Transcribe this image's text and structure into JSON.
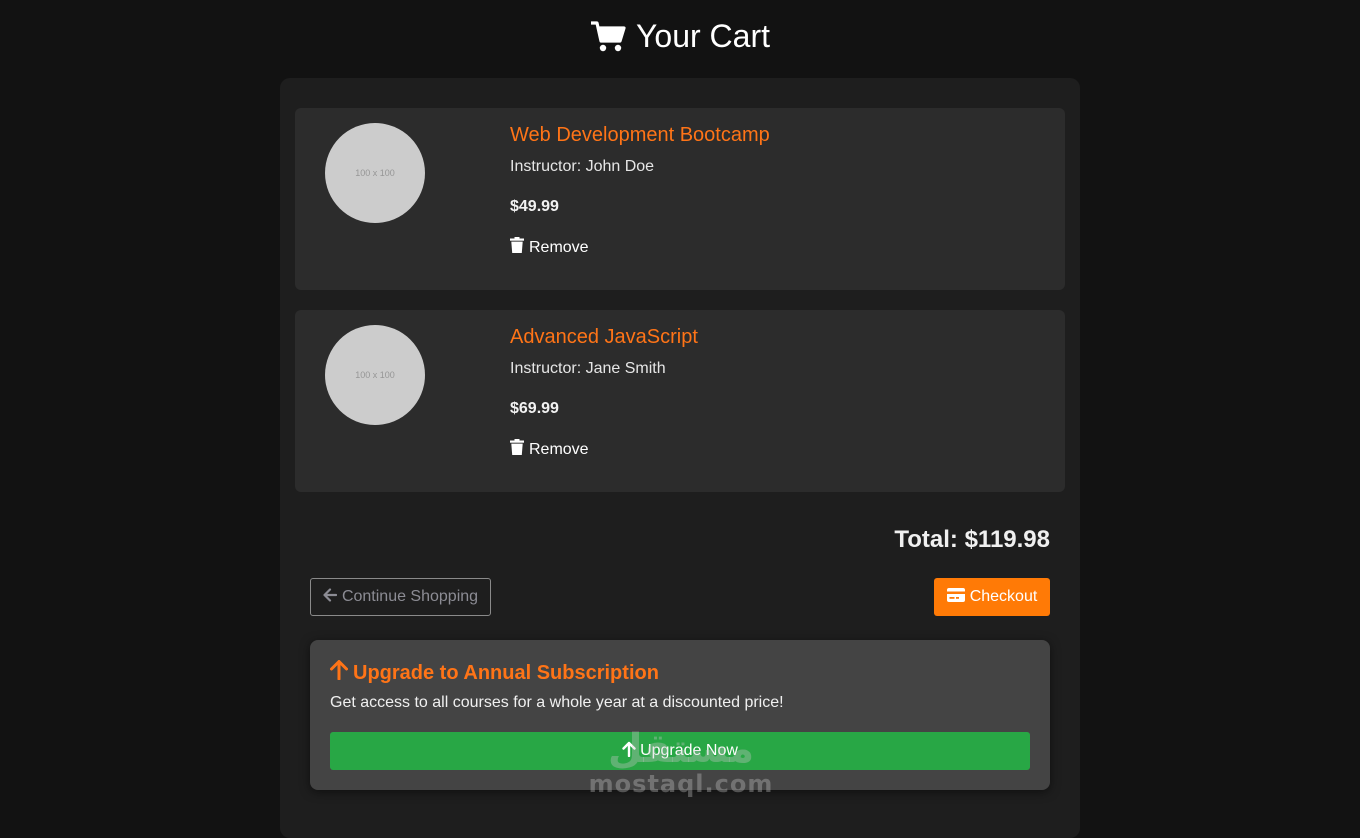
{
  "header": {
    "title": "Your Cart"
  },
  "courses": [
    {
      "title": "Web Development Bootcamp",
      "instructor": "Instructor: John Doe",
      "price": "$49.99",
      "thumb_text": "100 x 100",
      "remove_label": "Remove"
    },
    {
      "title": "Advanced JavaScript",
      "instructor": "Instructor: Jane Smith",
      "price": "$69.99",
      "thumb_text": "100 x 100",
      "remove_label": "Remove"
    }
  ],
  "summary": {
    "total": "Total: $119.98"
  },
  "actions": {
    "continue_label": "Continue Shopping",
    "checkout_label": "Checkout"
  },
  "upgrade": {
    "title": "Upgrade to Annual Subscription",
    "description": "Get access to all courses for a whole year at a discounted price!",
    "button_label": "Upgrade Now"
  },
  "watermark": {
    "logo": "مستقل",
    "text": "mostaql.com"
  },
  "colors": {
    "accent": "#ff7417",
    "checkout": "#ff7a06",
    "upgrade_button": "#28a745",
    "background": "#121212",
    "card": "#2c2c2c"
  },
  "icons": {
    "title": "cart-icon",
    "remove": "trash-icon",
    "continue": "arrow-left-icon",
    "checkout": "credit-card-icon",
    "upgrade": "arrow-up-icon"
  }
}
